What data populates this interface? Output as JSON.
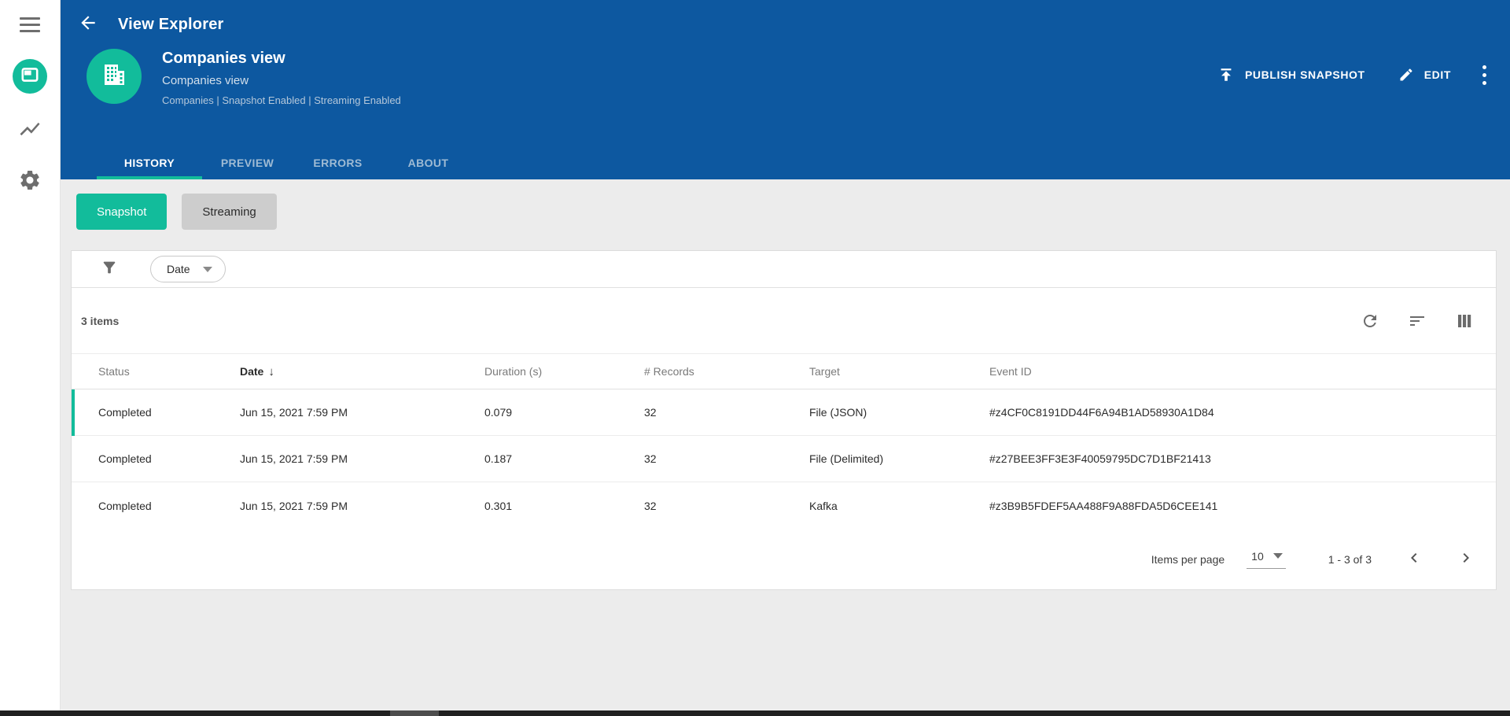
{
  "colors": {
    "header-blue": "#0d58a0",
    "accent": "#12bc9b",
    "page-bg": "#ececec"
  },
  "header": {
    "app_title": "View Explorer",
    "view": {
      "title": "Companies view",
      "subtitle": "Companies view",
      "meta": "Companies | Snapshot Enabled | Streaming Enabled"
    },
    "actions": {
      "publish_label": "PUBLISH SNAPSHOT",
      "edit_label": "EDIT"
    },
    "tabs": [
      {
        "label": "HISTORY"
      },
      {
        "label": "PREVIEW"
      },
      {
        "label": "ERRORS"
      },
      {
        "label": "ABOUT"
      }
    ]
  },
  "toggle": {
    "snapshot_label": "Snapshot",
    "streaming_label": "Streaming"
  },
  "filter": {
    "chip_label": "Date"
  },
  "table": {
    "items_count": "3 items",
    "columns": [
      "Status",
      "Date",
      "Duration (s)",
      "# Records",
      "Target",
      "Event ID"
    ],
    "sort": {
      "column": "Date",
      "indicator": "↓"
    },
    "rows": [
      {
        "status": "Completed",
        "date": "Jun 15, 2021 7:59 PM",
        "duration": "0.079",
        "records": "32",
        "target": "File (JSON)",
        "event_id": "#z4CF0C8191DD44F6A94B1AD58930A1D84"
      },
      {
        "status": "Completed",
        "date": "Jun 15, 2021 7:59 PM",
        "duration": "0.187",
        "records": "32",
        "target": "File (Delimited)",
        "event_id": "#z27BEE3FF3E3F40059795DC7D1BF21413"
      },
      {
        "status": "Completed",
        "date": "Jun 15, 2021 7:59 PM",
        "duration": "0.301",
        "records": "32",
        "target": "Kafka",
        "event_id": "#z3B9B5FDEF5AA488F9A88FDA5D6CEE141"
      }
    ],
    "pagination": {
      "items_per_page_label": "Items per page",
      "page_size": "10",
      "range": "1 - 3 of 3"
    }
  }
}
